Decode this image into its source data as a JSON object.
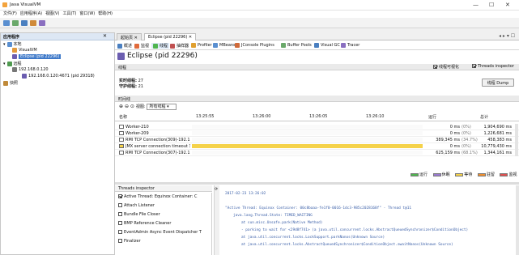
{
  "window": {
    "title": "Java VisualVM",
    "minimize": "—",
    "maximize": "☐",
    "close": "✕"
  },
  "menu": [
    "文件(F)",
    "应用程序(A)",
    "视图(V)",
    "工具(T)",
    "窗口(W)",
    "帮助(H)"
  ],
  "left_panel": {
    "title": "应用程序",
    "local": "本地",
    "visualvm": "VisualVM",
    "eclipse": "Eclipse (pid 22296)",
    "remote": "远程",
    "remote_host": "192.168.0.120",
    "remote_jmx": "192.168.0.120:4671 (pid 29318)",
    "snapshots": "快照"
  },
  "tabs": {
    "start": "起始页",
    "eclipse": "Eclipse (pid 22296)"
  },
  "subtabs": [
    "概述",
    "监视",
    "线程",
    "抽样器",
    "Profiler",
    "MBeans",
    "JConsole Plugins",
    "Buffer Pools",
    "Visual GC",
    "Tracer"
  ],
  "app_title": "Eclipse (pid 22296)",
  "threads": {
    "section": "线程",
    "visualize_label": "线程可视化",
    "inspector_label": "Threads inspector",
    "live_label": "实时线程:",
    "live_value": "27",
    "daemon_label": "守护线程:",
    "daemon_value": "21",
    "dump_button": "线程 Dump"
  },
  "timeline": {
    "section": "时间线",
    "view_label": "视图:",
    "view_value": "所有线程",
    "col_name": "名称",
    "col_run": "运行",
    "col_total": "总计",
    "ticks": [
      "13:25:55",
      "13:26:00",
      "13:26:05",
      "13:26:10"
    ],
    "rows": [
      {
        "name": "Worker-210",
        "run": "0 ms",
        "pct": "(0%)",
        "total": "1,904,690 ms",
        "color": "#d9d9d9"
      },
      {
        "name": "Worker-209",
        "run": "0 ms",
        "pct": "(0%)",
        "total": "1,226,681 ms",
        "color": "#d9d9d9"
      },
      {
        "name": "RMI TCP Connection(309)-192.168.0.120",
        "run": "389,345 ms",
        "pct": "(34.7%)",
        "total": "458,383 ms",
        "color": "#d9d9d9"
      },
      {
        "name": "JMX server connection timeout 305",
        "run": "0 ms",
        "pct": "(0%)",
        "total": "10,779,430 ms",
        "color": "#f5d24a"
      },
      {
        "name": "RMI TCP Connection(307)-192.168.0.120",
        "run": "625,159 ms",
        "pct": "(68.1%)",
        "total": "1,344,161 ms",
        "color": "#d9d9d9"
      }
    ],
    "legend": [
      {
        "label": "运行",
        "color": "#4fb54f"
      },
      {
        "label": "休眠",
        "color": "#9a7bd1"
      },
      {
        "label": "等待",
        "color": "#f5d24a"
      },
      {
        "label": "驻留",
        "color": "#f09030"
      },
      {
        "label": "监视",
        "color": "#e05050"
      }
    ]
  },
  "inspector": {
    "section": "Threads inspector",
    "list": [
      {
        "name": "Active Thread: Equinox Container: C",
        "checked": true
      },
      {
        "name": "Attach Listener",
        "checked": false
      },
      {
        "name": "Bundle File Closer",
        "checked": false
      },
      {
        "name": "BMP Reference Cleaner",
        "checked": false
      },
      {
        "name": "EventAdmin Async Event Dispatcher T",
        "checked": false
      },
      {
        "name": "Finalizer",
        "checked": false
      }
    ],
    "timestamp": "2017-02-23 13:26:02",
    "trace": [
      "\"Active Thread: Equinox Container: 00c8baaa-fe1f0-0016-1dc3-985c2028168f\" - Thread t@11",
      "java.lang.Thread.State: TIMED_WAITING",
      "at sun.misc.Unsafe.park(Native Method)",
      "- parking to wait for <29d8f741> (a java.util.concurrent.locks.AbstractQueuedSynchronizer$ConditionObject)",
      "at java.util.concurrent.locks.LockSupport.parkNanos(Unknown Source)",
      "at java.util.concurrent.locks.AbstractQueuedSynchronizer$ConditionObject.awaitNanos(Unknown Source)"
    ]
  }
}
